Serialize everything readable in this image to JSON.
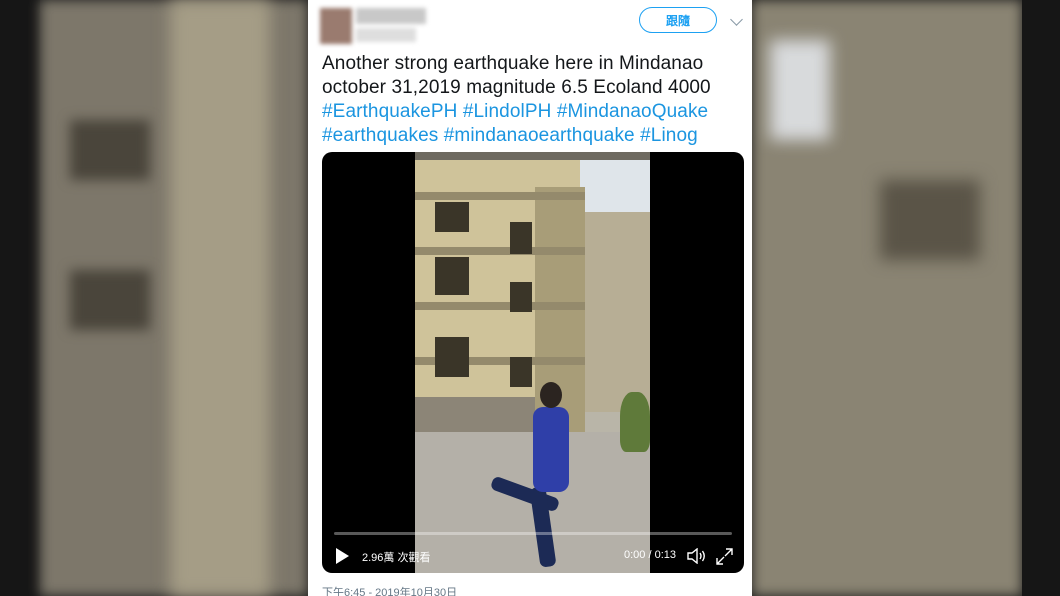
{
  "header": {
    "follow_label": "跟隨"
  },
  "tweet": {
    "lines": [
      "Another strong earthquake here in Mindanao",
      "october 31,2019 magnitude 6.5 Ecoland 4000"
    ],
    "hashtag_lines": [
      [
        "#EarthquakePH",
        "#LindolPH",
        "#MindanaoQuake"
      ],
      [
        "#earthquakes",
        "#mindanaoearthquake",
        "#Linog"
      ]
    ],
    "timestamp": "下午6:45 - 2019年10月30日"
  },
  "video": {
    "views": "2.96萬 次觀看",
    "time": "0:00 / 0:13",
    "progress": 0
  },
  "icons": {
    "play": "play-icon",
    "volume": "volume-icon",
    "fullscreen": "fullscreen-icon",
    "menu": "chevron-down-icon"
  },
  "colors": {
    "link": "#1b95e0",
    "follow": "#1da1f2",
    "text": "#14171a"
  }
}
